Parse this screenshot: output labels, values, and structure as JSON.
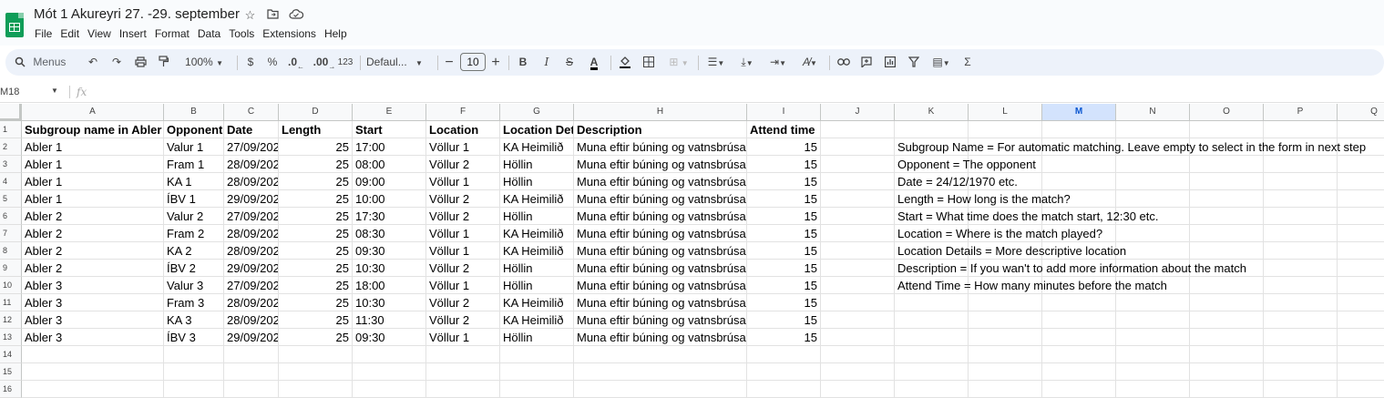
{
  "title": "Mót 1 Akureyri 27. -29. september",
  "title_icons": [
    "star-icon",
    "move-to-folder-icon",
    "cloud-status-icon"
  ],
  "menu": [
    "File",
    "Edit",
    "View",
    "Insert",
    "Format",
    "Data",
    "Tools",
    "Extensions",
    "Help"
  ],
  "toolbar": {
    "menus_label": "Menus",
    "zoom": "100%",
    "currency": "$",
    "percent": "%",
    "dec_decrease": ".0",
    "dec_increase": ".00",
    "format_123": "123",
    "font": "Defaul...",
    "font_size": "10"
  },
  "name_box": "M18",
  "fx": "fx",
  "columns": [
    "A",
    "B",
    "C",
    "D",
    "E",
    "F",
    "G",
    "H",
    "I",
    "J",
    "K",
    "L",
    "M",
    "N",
    "O",
    "P",
    "Q"
  ],
  "selected_column": "M",
  "rows": [
    "1",
    "2",
    "3",
    "4",
    "5",
    "6",
    "7",
    "8",
    "9",
    "10",
    "11",
    "12",
    "13",
    "14",
    "15",
    "16"
  ],
  "header_row": [
    "Subgroup name in Abler",
    "Opponent",
    "Date",
    "Length",
    "Start",
    "Location",
    "Location Det",
    "Description",
    "Attend time"
  ],
  "data_rows": [
    [
      "Abler 1",
      "Valur 1",
      "27/09/202",
      "25",
      "17:00",
      "Völlur 1",
      "KA Heimilið",
      "Muna eftir búning og vatnsbrúsa",
      "15"
    ],
    [
      "Abler 1",
      "Fram 1",
      "28/09/202",
      "25",
      "08:00",
      "Völlur 2",
      "Höllin",
      "Muna eftir búning og vatnsbrúsa",
      "15"
    ],
    [
      "Abler 1",
      "KA 1",
      "28/09/202",
      "25",
      "09:00",
      "Völlur 1",
      "Höllin",
      "Muna eftir búning og vatnsbrúsa",
      "15"
    ],
    [
      "Abler 1",
      "ÍBV 1",
      "29/09/202",
      "25",
      "10:00",
      "Völlur 2",
      "KA Heimilið",
      "Muna eftir búning og vatnsbrúsa",
      "15"
    ],
    [
      "Abler 2",
      "Valur 2",
      "27/09/202",
      "25",
      "17:30",
      "Völlur 2",
      "Höllin",
      "Muna eftir búning og vatnsbrúsa",
      "15"
    ],
    [
      "Abler 2",
      "Fram 2",
      "28/09/202",
      "25",
      "08:30",
      "Völlur 1",
      "KA Heimilið",
      "Muna eftir búning og vatnsbrúsa",
      "15"
    ],
    [
      "Abler 2",
      "KA 2",
      "28/09/202",
      "25",
      "09:30",
      "Völlur 1",
      "KA Heimilið",
      "Muna eftir búning og vatnsbrúsa",
      "15"
    ],
    [
      "Abler 2",
      "ÍBV 2",
      "29/09/202",
      "25",
      "10:30",
      "Völlur 2",
      "Höllin",
      "Muna eftir búning og vatnsbrúsa",
      "15"
    ],
    [
      "Abler 3",
      "Valur 3",
      "27/09/202",
      "25",
      "18:00",
      "Völlur 1",
      "Höllin",
      "Muna eftir búning og vatnsbrúsa",
      "15"
    ],
    [
      "Abler 3",
      "Fram 3",
      "28/09/202",
      "25",
      "10:30",
      "Völlur 2",
      "KA Heimilið",
      "Muna eftir búning og vatnsbrúsa",
      "15"
    ],
    [
      "Abler 3",
      "KA 3",
      "28/09/202",
      "25",
      "11:30",
      "Völlur 2",
      "KA Heimilið",
      "Muna eftir búning og vatnsbrúsa",
      "15"
    ],
    [
      "Abler 3",
      "ÍBV 3",
      "29/09/202",
      "25",
      "09:30",
      "Völlur 1",
      "Höllin",
      "Muna eftir búning og vatnsbrúsa",
      "15"
    ]
  ],
  "notes": [
    "Subgroup Name = For automatic matching. Leave empty to select in the form in next step",
    "Opponent = The opponent",
    "Date = 24/12/1970 etc.",
    "Length = How long is the match?",
    "Start = What time does the match start, 12:30 etc.",
    "Location = Where is the match played?",
    "Location Details = More descriptive location",
    "Description = If you wan't to add more information about the match",
    "Attend Time = How many minutes before the match"
  ]
}
